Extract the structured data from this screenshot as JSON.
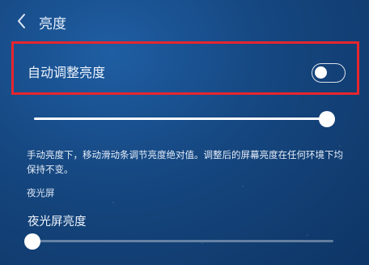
{
  "header": {
    "title": "亮度",
    "back_icon": "chevron-left-icon"
  },
  "auto_brightness": {
    "label": "自动调整亮度",
    "enabled": false
  },
  "brightness_slider": {
    "level": 1.0
  },
  "description": "手动亮度下，移动滑动条调节亮度绝对值。调整后的屏幕亮度在任何环境下均保持不变。",
  "night_screen": {
    "section_label": "夜光屏",
    "label": "夜光屏亮度",
    "level": 0.0
  },
  "colors": {
    "highlight": "#e6262e",
    "background": "#15467f"
  }
}
